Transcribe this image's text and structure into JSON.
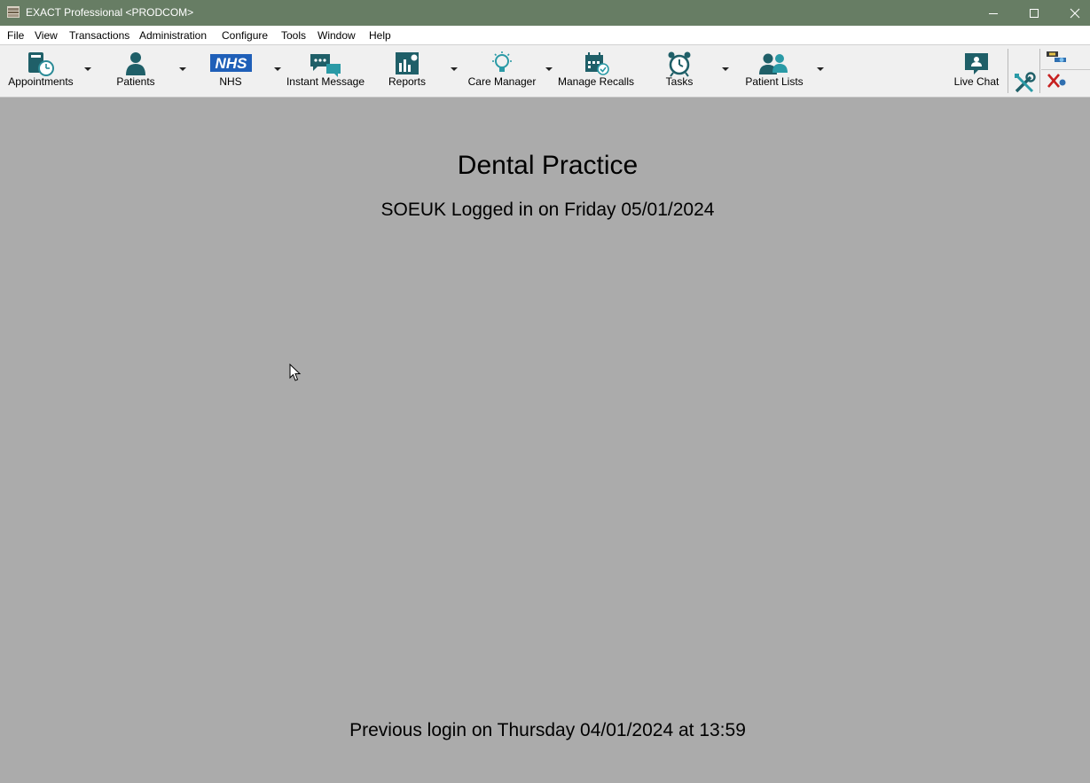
{
  "window": {
    "title": "EXACT Professional <PRODCOM>",
    "controls": [
      "minimize",
      "maximize",
      "close"
    ],
    "titlebar_color": "#677d64"
  },
  "menu": {
    "items": [
      "File",
      "View",
      "Transactions",
      "Administration",
      "Configure",
      "Tools",
      "Window",
      "Help"
    ]
  },
  "toolbar": {
    "accent_color": "#1f5f68",
    "buttons": [
      {
        "label": "Appointments",
        "icon": "appointments-clock-icon",
        "dropdown": true
      },
      {
        "label": "Patients",
        "icon": "patient-person-icon",
        "dropdown": true
      },
      {
        "label": "NHS",
        "icon": "nhs-logo-icon",
        "dropdown": true
      },
      {
        "label": "Instant Message",
        "icon": "chat-bubbles-icon",
        "dropdown": false
      },
      {
        "label": "Reports",
        "icon": "bar-chart-icon",
        "dropdown": true
      },
      {
        "label": "Care Manager",
        "icon": "lightbulb-icon",
        "dropdown": true
      },
      {
        "label": "Manage Recalls",
        "icon": "calendar-check-icon",
        "dropdown": false
      },
      {
        "label": "Tasks",
        "icon": "alarm-clock-icon",
        "dropdown": true
      },
      {
        "label": "Patient Lists",
        "icon": "people-group-icon",
        "dropdown": true
      },
      {
        "label": "Live Chat",
        "icon": "chat-support-icon",
        "dropdown": false
      }
    ],
    "tools_icon": "tools-wrench-icon",
    "connect_icon": "network-connect-icon",
    "disconnect_icon": "disconnect-x-icon"
  },
  "main": {
    "practice_name": "Dental Practice",
    "login_text": "SOEUK Logged in on Friday 05/01/2024",
    "previous_login": "Previous login on Thursday 04/01/2024 at 13:59",
    "background_color": "#ababab"
  }
}
